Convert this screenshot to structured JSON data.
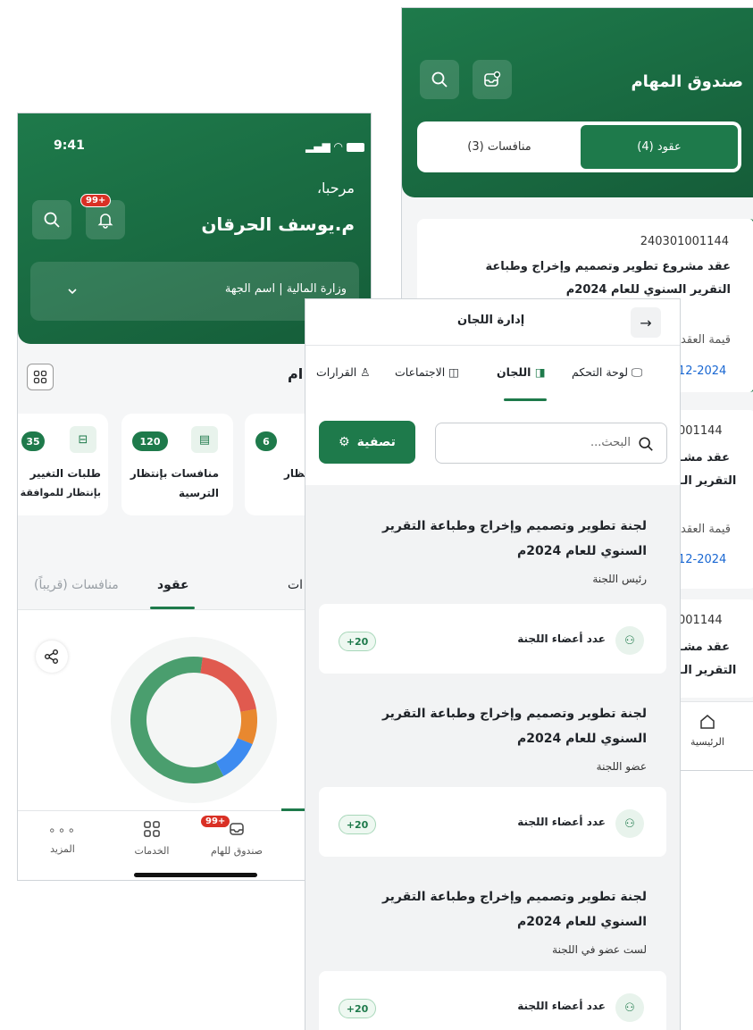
{
  "screen_a": {
    "title": "صندوق المهام",
    "tabs": [
      {
        "label": "عقود (4)"
      },
      {
        "label": "منافسات (3)"
      }
    ],
    "cards": [
      {
        "number": "240301001144",
        "title_l1": "عقد مشروع تطوير وتصميم وإخراج وطباعة",
        "title_l2": "التقرير السنوي للعام 2024م",
        "value_label": "قيمة العقد",
        "date": "12-2024"
      },
      {
        "number": "001144",
        "title_l1": "عقد مشـ",
        "title_l2": "التقرير الـ",
        "value_label": "قيمة العقد",
        "date": "12-2024"
      },
      {
        "number": "001144",
        "title_l1": "عقد مشـ",
        "title_l2": "التقرير الـ"
      }
    ],
    "nav_home": "الرئيسية"
  },
  "screen_b": {
    "status_time": "9:41",
    "greeting": "مرحبا،",
    "user_name": "م.يوسف الحرقان",
    "notif_badge": "99+",
    "entity": "وزارة المالية | اسم الجهة",
    "section_title": "ام",
    "stats": [
      {
        "count": "35",
        "label_l1": "طلبات التغيير",
        "label_l2": "بإنتظار للموافقة"
      },
      {
        "count": "120",
        "label_l1": "منافسات بإنتظار",
        "label_l2": "الترسية"
      },
      {
        "count": "6",
        "label_l1": "نظار",
        "label_l2": ""
      }
    ],
    "tabs": [
      {
        "label": "منافسات (قريباً)"
      },
      {
        "label": "عقود"
      },
      {
        "label": "ات"
      }
    ],
    "donut": [
      {
        "color": "#4a9e6e",
        "value": 60
      },
      {
        "color": "#e05a4f",
        "value": 20
      },
      {
        "color": "#e8882f",
        "value": 9
      },
      {
        "color": "#3d8bf0",
        "value": 11
      }
    ],
    "bottom_nav": [
      {
        "label": "المزيد"
      },
      {
        "label": "الخدمات"
      },
      {
        "label": "صندوق للهام",
        "badge": "99+"
      }
    ]
  },
  "screen_c": {
    "title": "إدارة اللجان",
    "tabs": [
      {
        "label": "لوحة التحكم"
      },
      {
        "label": "اللجان"
      },
      {
        "label": "الاجتماعات"
      },
      {
        "label": "القرارات"
      }
    ],
    "search_placeholder": "البحث...",
    "filter_label": "تصفية",
    "committees": [
      {
        "name_l1": "لجنة تطوير وتصميم وإخراج وطباعة التقرير",
        "name_l2": "السنوي للعام 2024م",
        "role": "رئيس اللجنة",
        "members_label": "عدد أعضاء اللجنة",
        "members_count": "+20"
      },
      {
        "name_l1": "لجنة تطوير وتصميم وإخراج وطباعة التقرير",
        "name_l2": "السنوي للعام 2024م",
        "role": "عضو اللجنة",
        "members_label": "عدد أعضاء اللجنة",
        "members_count": "+20"
      },
      {
        "name_l1": "لجنة تطوير وتصميم وإخراج وطباعة التقرير",
        "name_l2": "السنوي للعام 2024م",
        "role": "لست عضو في اللجنة",
        "members_label": "عدد أعضاء اللجنة",
        "members_count": "+20"
      }
    ]
  }
}
